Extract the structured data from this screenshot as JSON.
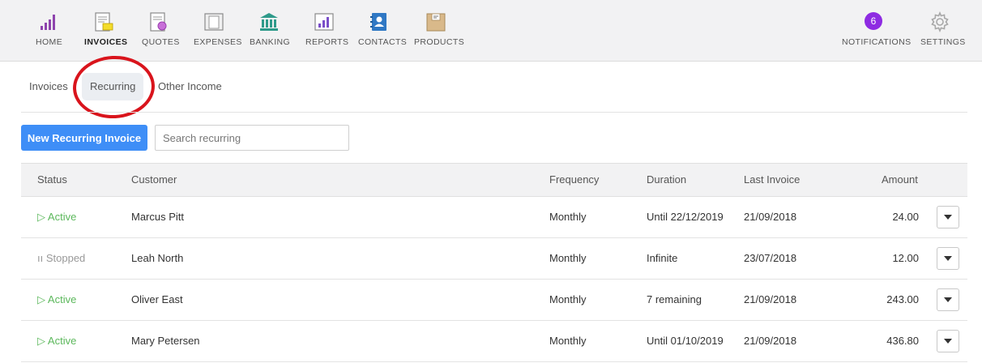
{
  "nav": {
    "items": [
      {
        "label": "HOME",
        "icon": "home-chart-icon"
      },
      {
        "label": "INVOICES",
        "icon": "invoice-icon"
      },
      {
        "label": "QUOTES",
        "icon": "quote-icon"
      },
      {
        "label": "EXPENSES",
        "icon": "expenses-icon"
      },
      {
        "label": "BANKING",
        "icon": "bank-icon"
      },
      {
        "label": "REPORTS",
        "icon": "reports-icon"
      },
      {
        "label": "CONTACTS",
        "icon": "contacts-icon"
      },
      {
        "label": "PRODUCTS",
        "icon": "products-icon"
      }
    ],
    "active": "INVOICES",
    "notifications_label": "NOTIFICATIONS",
    "notifications_count": "6",
    "settings_label": "SETTINGS"
  },
  "subtabs": [
    {
      "label": "Invoices"
    },
    {
      "label": "Recurring"
    },
    {
      "label": "Other Income"
    }
  ],
  "toolbar": {
    "new_label": "New Recurring Invoice",
    "search_placeholder": "Search recurring"
  },
  "table": {
    "headers": {
      "status": "Status",
      "customer": "Customer",
      "frequency": "Frequency",
      "duration": "Duration",
      "last_invoice": "Last Invoice",
      "amount": "Amount"
    },
    "rows": [
      {
        "status": "Active",
        "customer": "Marcus Pitt",
        "frequency": "Monthly",
        "duration": "Until 22/12/2019",
        "last_invoice": "21/09/2018",
        "amount": "24.00"
      },
      {
        "status": "Stopped",
        "customer": "Leah North",
        "frequency": "Monthly",
        "duration": "Infinite",
        "last_invoice": "23/07/2018",
        "amount": "12.00"
      },
      {
        "status": "Active",
        "customer": "Oliver East",
        "frequency": "Monthly",
        "duration": "7 remaining",
        "last_invoice": "21/09/2018",
        "amount": "243.00"
      },
      {
        "status": "Active",
        "customer": "Mary Petersen",
        "frequency": "Monthly",
        "duration": "Until 01/10/2019",
        "last_invoice": "21/09/2018",
        "amount": "436.80"
      }
    ]
  },
  "colors": {
    "primary_button": "#3e8ef7",
    "active_status": "#5cb85c",
    "stopped_status": "#999999",
    "badge": "#8e2be2",
    "highlight_circle": "#d9141c"
  }
}
